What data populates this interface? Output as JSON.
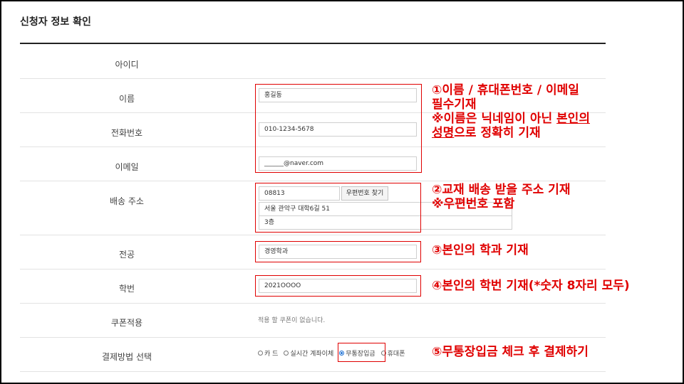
{
  "page": {
    "title": "신청자 정보 확인"
  },
  "form": {
    "id_label": "아이디",
    "name_label": "이름",
    "name_value": "홍길동",
    "phone_label": "전화번호",
    "phone_value": "010-1234-5678",
    "email_label": "이메일",
    "email_value": "______@naver.com",
    "address_label": "배송 주소",
    "zip_value": "08813",
    "zip_button": "우편번호 찾기",
    "address1_value": "서울 관악구 대학6길 51",
    "address2_value": "3층",
    "major_label": "전공",
    "major_value": "경영학과",
    "student_id_label": "학번",
    "student_id_value": "2021OOOO",
    "coupon_label": "쿠폰적용",
    "coupon_text": "적용 할 쿠폰이 없습니다.",
    "payment_label": "결제방법 선택",
    "payment_options": [
      {
        "label": "카 드",
        "checked": false
      },
      {
        "label": "실시간 계좌이체",
        "checked": false
      },
      {
        "label": "무통장입금",
        "checked": true
      },
      {
        "label": "휴대폰",
        "checked": false
      }
    ]
  },
  "annotations": {
    "a1_line1": "①이름 / 휴대폰번호 / 이메일",
    "a1_line2": "필수기재",
    "a1_line3_pre": "※이름은 닉네임이 아닌 ",
    "a1_line3_u": "본인의",
    "a1_line4_u": "성명",
    "a1_line4_post": "으로 정확히 기재",
    "a2_line1": "②교재 배송 받을 주소 기재",
    "a2_line2": "※우편번호 포함",
    "a3": "③본인의 학과 기재",
    "a4": "④본인의 학번 기재(*숫자 8자리 모두)",
    "a5": "⑤무통장입금 체크 후 결제하기"
  },
  "colors": {
    "annotation": "#e00000",
    "radio_checked": "#1a6fd4"
  }
}
